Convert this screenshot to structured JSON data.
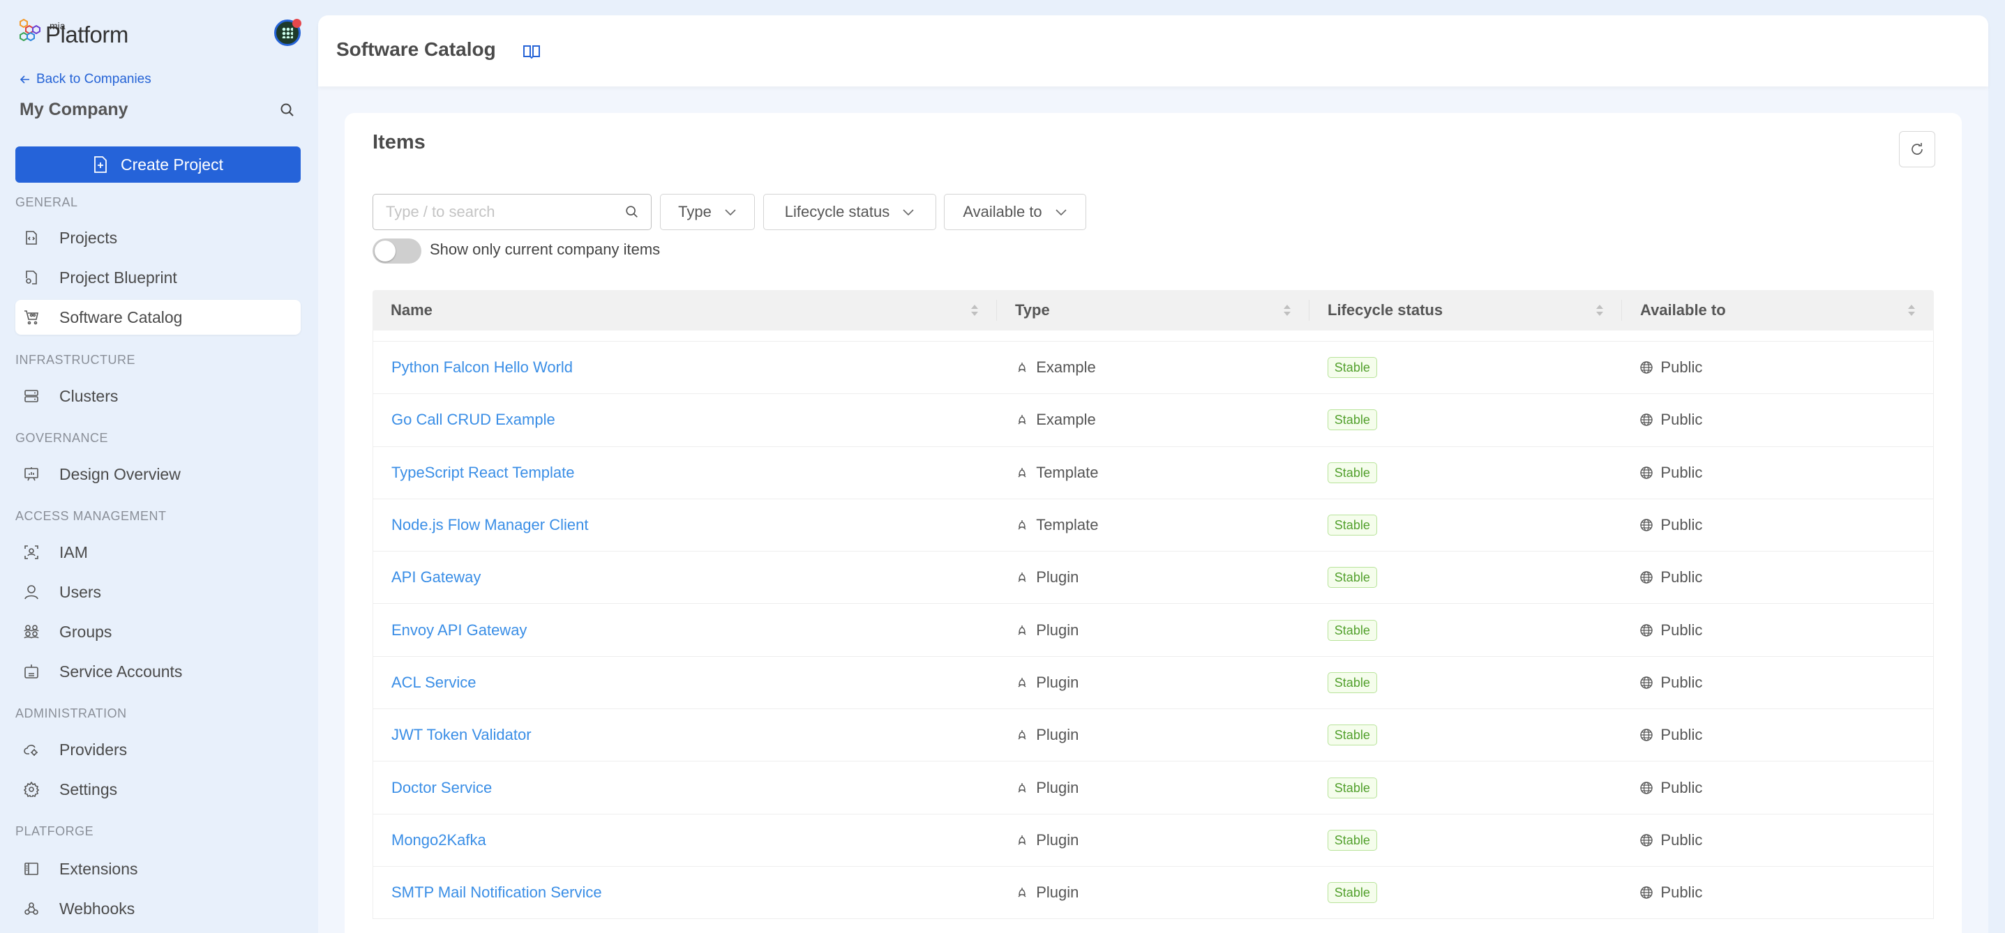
{
  "sidebar": {
    "logo": {
      "small": "mia",
      "main": "Platform"
    },
    "back_link": "Back to Companies",
    "company_name": "My Company",
    "create_button": "Create Project",
    "sections": [
      {
        "label": "GENERAL",
        "items": [
          {
            "label": "Projects",
            "icon": "file-code-icon"
          },
          {
            "label": "Project Blueprint",
            "icon": "file-gear-icon"
          },
          {
            "label": "Software Catalog",
            "icon": "cart-icon",
            "active": true
          }
        ]
      },
      {
        "label": "INFRASTRUCTURE",
        "items": [
          {
            "label": "Clusters",
            "icon": "server-icon"
          }
        ]
      },
      {
        "label": "GOVERNANCE",
        "items": [
          {
            "label": "Design Overview",
            "icon": "presentation-icon"
          }
        ]
      },
      {
        "label": "ACCESS MANAGEMENT",
        "items": [
          {
            "label": "IAM",
            "icon": "user-scan-icon"
          },
          {
            "label": "Users",
            "icon": "user-icon"
          },
          {
            "label": "Groups",
            "icon": "group-icon"
          },
          {
            "label": "Service Accounts",
            "icon": "robot-icon"
          }
        ]
      },
      {
        "label": "ADMINISTRATION",
        "items": [
          {
            "label": "Providers",
            "icon": "cloud-gear-icon"
          },
          {
            "label": "Settings",
            "icon": "gear-icon"
          }
        ]
      },
      {
        "label": "PLATFORGE",
        "items": [
          {
            "label": "Extensions",
            "icon": "sidebar-layout-icon"
          },
          {
            "label": "Webhooks",
            "icon": "webhook-icon"
          }
        ]
      }
    ]
  },
  "header": {
    "title": "Software Catalog"
  },
  "items": {
    "title": "Items",
    "search_placeholder": "Type / to search",
    "filters": [
      "Type",
      "Lifecycle status",
      "Available to"
    ],
    "toggle_label": "Show only current company items",
    "toggle_on": false,
    "columns": [
      "Name",
      "Type",
      "Lifecycle status",
      "Available to"
    ],
    "rows": [
      {
        "name": "Python Falcon Hello World",
        "type": "Example",
        "status": "Stable",
        "available": "Public"
      },
      {
        "name": "Go Call CRUD Example",
        "type": "Example",
        "status": "Stable",
        "available": "Public"
      },
      {
        "name": "TypeScript React Template",
        "type": "Template",
        "status": "Stable",
        "available": "Public"
      },
      {
        "name": "Node.js Flow Manager Client",
        "type": "Template",
        "status": "Stable",
        "available": "Public"
      },
      {
        "name": "API Gateway",
        "type": "Plugin",
        "status": "Stable",
        "available": "Public"
      },
      {
        "name": "Envoy API Gateway",
        "type": "Plugin",
        "status": "Stable",
        "available": "Public"
      },
      {
        "name": "ACL Service",
        "type": "Plugin",
        "status": "Stable",
        "available": "Public"
      },
      {
        "name": "JWT Token Validator",
        "type": "Plugin",
        "status": "Stable",
        "available": "Public"
      },
      {
        "name": "Doctor Service",
        "type": "Plugin",
        "status": "Stable",
        "available": "Public"
      },
      {
        "name": "Mongo2Kafka",
        "type": "Plugin",
        "status": "Stable",
        "available": "Public"
      },
      {
        "name": "SMTP Mail Notification Service",
        "type": "Plugin",
        "status": "Stable",
        "available": "Public"
      }
    ]
  },
  "colors": {
    "primary": "#2563d9",
    "link": "#3a8ee6",
    "badge_green": "#52a02c",
    "sidebar_bg": "#e8f0fb"
  }
}
